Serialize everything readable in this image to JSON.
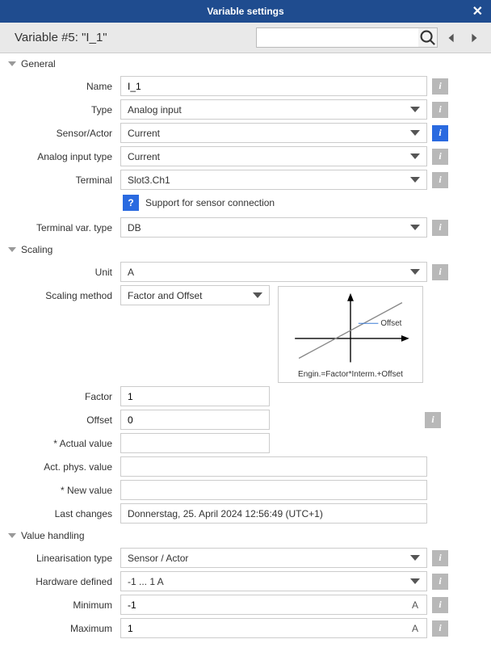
{
  "titlebar": {
    "title": "Variable settings"
  },
  "header": {
    "title": "Variable #5: \"I_1\"",
    "search_placeholder": ""
  },
  "sections": {
    "general": {
      "title": "General",
      "name_label": "Name",
      "name_value": "I_1",
      "type_label": "Type",
      "type_value": "Analog input",
      "sensor_label": "Sensor/Actor",
      "sensor_value": "Current",
      "ain_type_label": "Analog input type",
      "ain_type_value": "Current",
      "terminal_label": "Terminal",
      "terminal_value": "Slot3.Ch1",
      "support_text": "Support for sensor connection",
      "tvar_label": "Terminal var. type",
      "tvar_value": "DB"
    },
    "scaling": {
      "title": "Scaling",
      "unit_label": "Unit",
      "unit_value": "A",
      "method_label": "Scaling method",
      "method_value": "Factor and Offset",
      "factor_label": "Factor",
      "factor_value": "1",
      "offset_label": "Offset",
      "offset_value": "0",
      "diagram_offset": "Offset",
      "diagram_caption": "Engin.=Factor*Interm.+Offset",
      "actual_label": "* Actual value",
      "actual_value": "",
      "actphys_label": "Act. phys. value",
      "actphys_value": "",
      "newval_label": "* New value",
      "newval_value": "",
      "last_label": "Last changes",
      "last_value": "Donnerstag, 25. April 2024   12:56:49 (UTC+1)"
    },
    "valhandling": {
      "title": "Value handling",
      "lin_label": "Linearisation type",
      "lin_value": "Sensor / Actor",
      "hw_label": "Hardware defined",
      "hw_value": "-1 ... 1 A",
      "min_label": "Minimum",
      "min_value": "-1",
      "min_unit": "A",
      "max_label": "Maximum",
      "max_value": "1",
      "max_unit": "A"
    }
  },
  "info_glyph": "i",
  "help_glyph": "?"
}
